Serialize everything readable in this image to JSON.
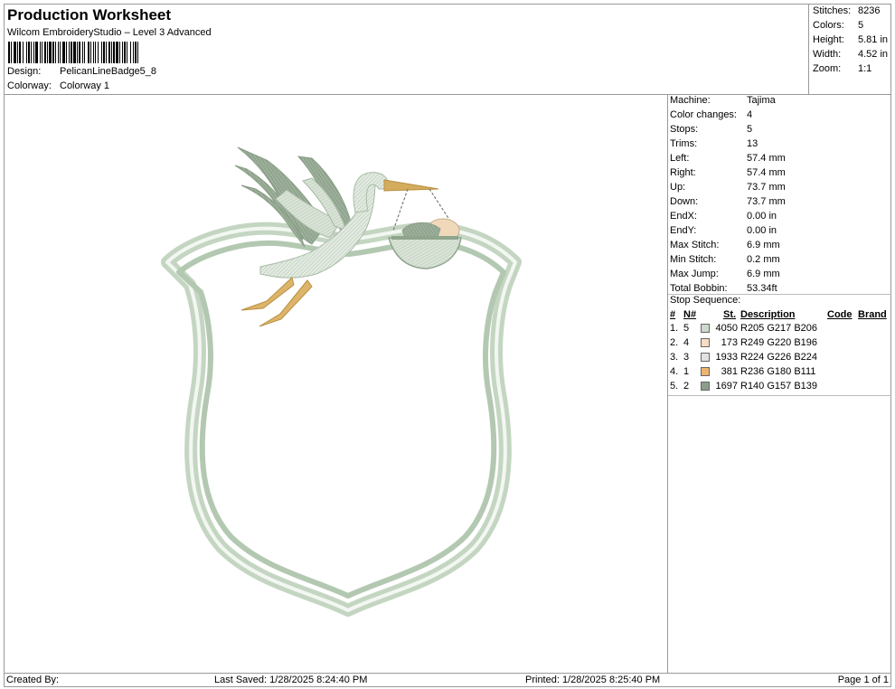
{
  "header": {
    "title": "Production Worksheet",
    "subtitle": "Wilcom EmbroideryStudio – Level 3 Advanced",
    "design_label": "Design:",
    "design_value": "PelicanLineBadge5_8",
    "colorway_label": "Colorway:",
    "colorway_value": "Colorway 1"
  },
  "summary": {
    "stitches_label": "Stitches:",
    "stitches_value": "8236",
    "colors_label": "Colors:",
    "colors_value": "5",
    "height_label": "Height:",
    "height_value": "5.81 in",
    "width_label": "Width:",
    "width_value": "4.52 in",
    "zoom_label": "Zoom:",
    "zoom_value": "1:1"
  },
  "info": {
    "machine_label": "Machine:",
    "machine_value": "Tajima",
    "color_changes_label": "Color changes:",
    "color_changes_value": "4",
    "stops_label": "Stops:",
    "stops_value": "5",
    "trims_label": "Trims:",
    "trims_value": "13",
    "left_label": "Left:",
    "left_value": "57.4 mm",
    "right_label": "Right:",
    "right_value": "57.4 mm",
    "up_label": "Up:",
    "up_value": "73.7 mm",
    "down_label": "Down:",
    "down_value": "73.7 mm",
    "endx_label": "EndX:",
    "endx_value": "0.00 in",
    "endy_label": "EndY:",
    "endy_value": "0.00 in",
    "max_stitch_label": "Max Stitch:",
    "max_stitch_value": "6.9 mm",
    "min_stitch_label": "Min Stitch:",
    "min_stitch_value": "0.2 mm",
    "max_jump_label": "Max Jump:",
    "max_jump_value": "6.9 mm",
    "total_bobbin_label": "Total Bobbin:",
    "total_bobbin_value": "53.34ft"
  },
  "stop_sequence": {
    "title": "Stop Sequence:",
    "headers": {
      "num": "#",
      "n": "N#",
      "st": "St.",
      "description": "Description",
      "code": "Code",
      "brand": "Brand"
    },
    "rows": [
      {
        "num": "1.",
        "n": "5",
        "st": "4050",
        "description": "R205 G217 B206",
        "color": "#cdd9ce"
      },
      {
        "num": "2.",
        "n": "4",
        "st": "173",
        "description": "R249 G220 B196",
        "color": "#f9dcc4"
      },
      {
        "num": "3.",
        "n": "3",
        "st": "1933",
        "description": "R224 G226 B224",
        "color": "#e0e2e0"
      },
      {
        "num": "4.",
        "n": "1",
        "st": "381",
        "description": "R236 G180 B111",
        "color": "#ecb46f"
      },
      {
        "num": "5.",
        "n": "2",
        "st": "1697",
        "description": "R140 G157 B139",
        "color": "#8c9d8b"
      }
    ]
  },
  "footer": {
    "created_by": "Created By:",
    "last_saved": "Last Saved: 1/28/2025 8:24:40 PM",
    "printed": "Printed: 1/28/2025 8:25:40 PM",
    "page": "Page 1 of 1"
  }
}
